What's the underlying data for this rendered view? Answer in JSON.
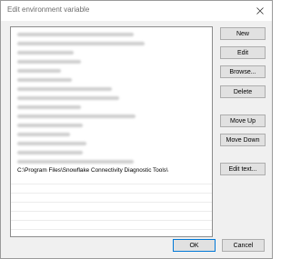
{
  "window": {
    "title": "Edit environment variable",
    "close_icon": "close-icon"
  },
  "list": {
    "items": [
      {
        "text": "",
        "blurred": true
      },
      {
        "text": "",
        "blurred": true
      },
      {
        "text": "",
        "blurred": true
      },
      {
        "text": "",
        "blurred": true
      },
      {
        "text": "",
        "blurred": true
      },
      {
        "text": "",
        "blurred": true
      },
      {
        "text": "",
        "blurred": true
      },
      {
        "text": "",
        "blurred": true
      },
      {
        "text": "",
        "blurred": true
      },
      {
        "text": "",
        "blurred": true
      },
      {
        "text": "",
        "blurred": true
      },
      {
        "text": "",
        "blurred": true
      },
      {
        "text": "",
        "blurred": true
      },
      {
        "text": "",
        "blurred": true
      },
      {
        "text": "",
        "blurred": true
      },
      {
        "text": "C:\\Program Files\\Snowflake Connectivity Diagnostic Tools\\",
        "blurred": false
      }
    ]
  },
  "buttons": {
    "new": "New",
    "edit": "Edit",
    "browse": "Browse...",
    "delete": "Delete",
    "move_up": "Move Up",
    "move_down": "Move Down",
    "edit_text": "Edit text...",
    "ok": "OK",
    "cancel": "Cancel"
  },
  "colors": {
    "default_button_border": "#0078d7",
    "button_face": "#e1e1e1",
    "dialog_background": "#f0f0f0"
  }
}
